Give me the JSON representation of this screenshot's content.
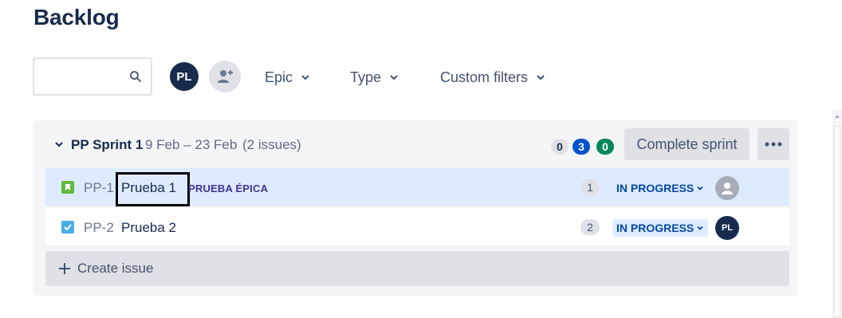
{
  "page": {
    "title": "Backlog"
  },
  "search": {
    "placeholder": "",
    "value": ""
  },
  "filters": {
    "avatar_initials": "PL",
    "epic_label": "Epic",
    "type_label": "Type",
    "custom_label": "Custom filters"
  },
  "sprint": {
    "name": "PP Sprint 1",
    "dates": "9 Feb – 23 Feb",
    "issue_count": "(2 issues)",
    "counts": {
      "todo": "0",
      "in_progress": "3",
      "done": "0"
    },
    "complete_label": "Complete sprint",
    "more_label": "•••",
    "issues": [
      {
        "type": "story",
        "key": "PP-1",
        "summary": "Prueba 1",
        "epic": "PRUEBA ÉPICA",
        "estimate": "1",
        "status": "IN PROGRESS",
        "assignee": ""
      },
      {
        "type": "task",
        "key": "PP-2",
        "summary": "Prueba 2",
        "epic": "",
        "estimate": "2",
        "status": "IN PROGRESS",
        "assignee": "PL"
      }
    ],
    "create_label": "Create issue"
  },
  "colors": {
    "brand_dark": "#172b4d",
    "story_green": "#63ba3c",
    "task_blue": "#4bade8",
    "epic_purple": "#403294",
    "status_blue": "#0747a6",
    "selected_row": "#deebff"
  }
}
